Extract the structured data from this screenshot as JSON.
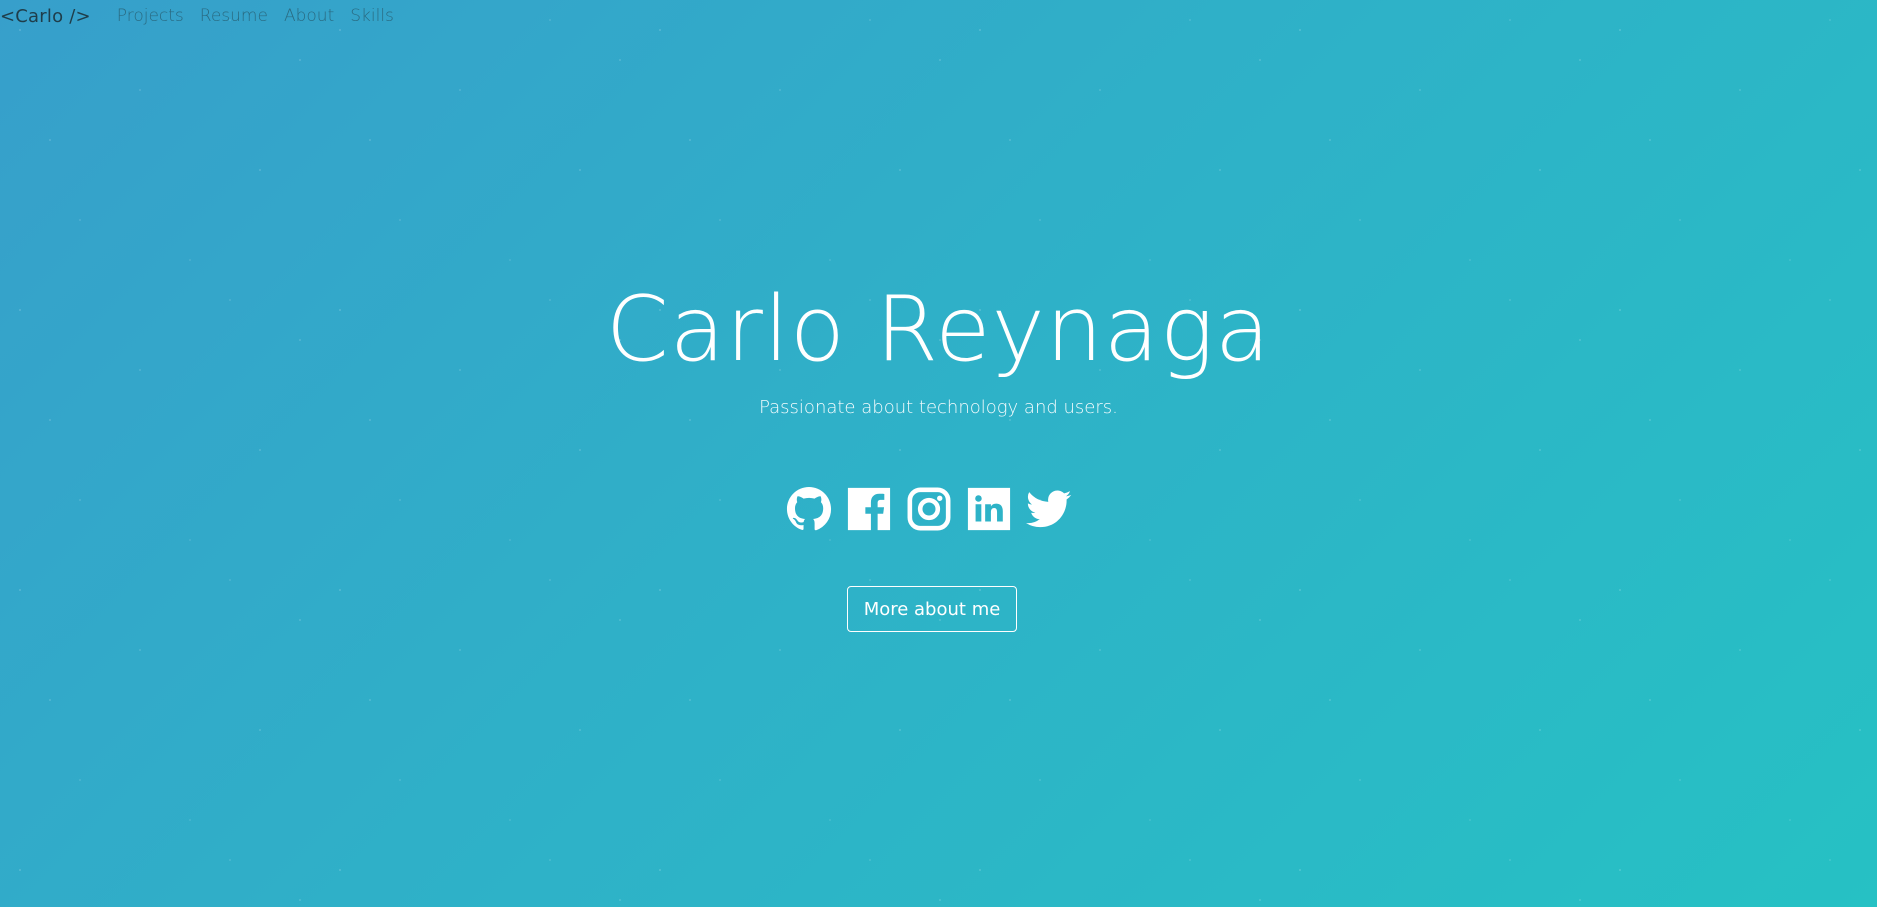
{
  "nav": {
    "brand": "<Carlo />",
    "links": [
      "Projects",
      "Resume",
      "About",
      "Skills"
    ]
  },
  "hero": {
    "name": "Carlo Reynaga",
    "tagline": "Passionate about technology and users.",
    "button_label": "More about me"
  },
  "socials": [
    {
      "icon": "github-icon"
    },
    {
      "icon": "facebook-icon"
    },
    {
      "icon": "instagram-icon"
    },
    {
      "icon": "linkedin-icon"
    },
    {
      "icon": "twitter-icon"
    }
  ],
  "colors": {
    "gradient_start": "#379fcb",
    "gradient_end": "#26c1c4",
    "text": "#ffffff",
    "brand_text": "#1f3d4a",
    "nav_link": "#2a6b82"
  }
}
